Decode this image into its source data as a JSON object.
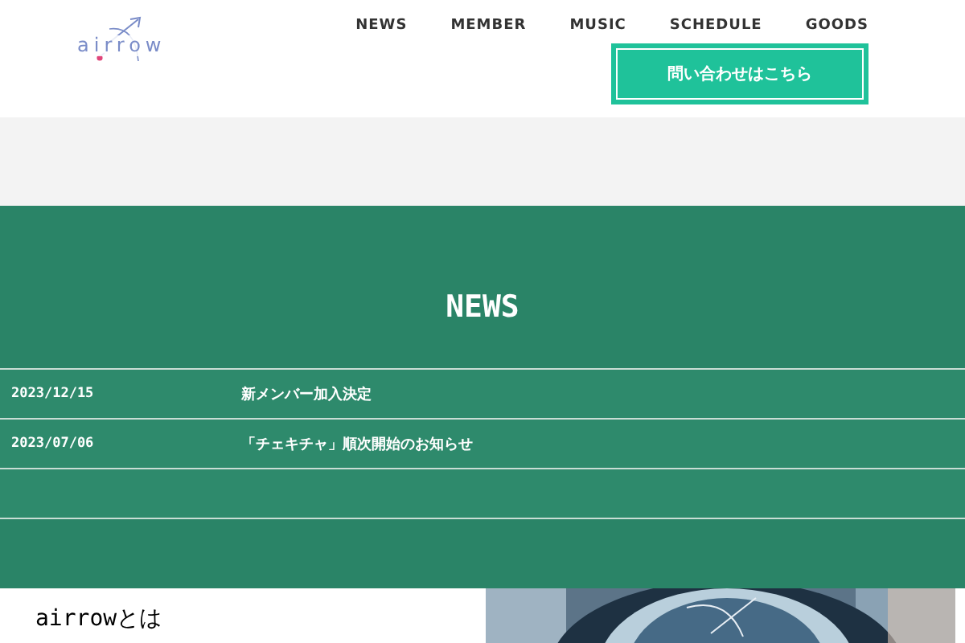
{
  "header": {
    "logo": "airrow",
    "nav": [
      "NEWS",
      "MEMBER",
      "MUSIC",
      "SCHEDULE",
      "GOODS"
    ],
    "contact_button": "問い合わせはこちら"
  },
  "news": {
    "title": "NEWS",
    "items": [
      {
        "date": "2023/12/15",
        "title": "新メンバー加入決定"
      },
      {
        "date": "2023/07/06",
        "title": "「チェキチャ」順次開始のお知らせ"
      }
    ]
  },
  "about": {
    "heading": "airrowとは"
  }
}
